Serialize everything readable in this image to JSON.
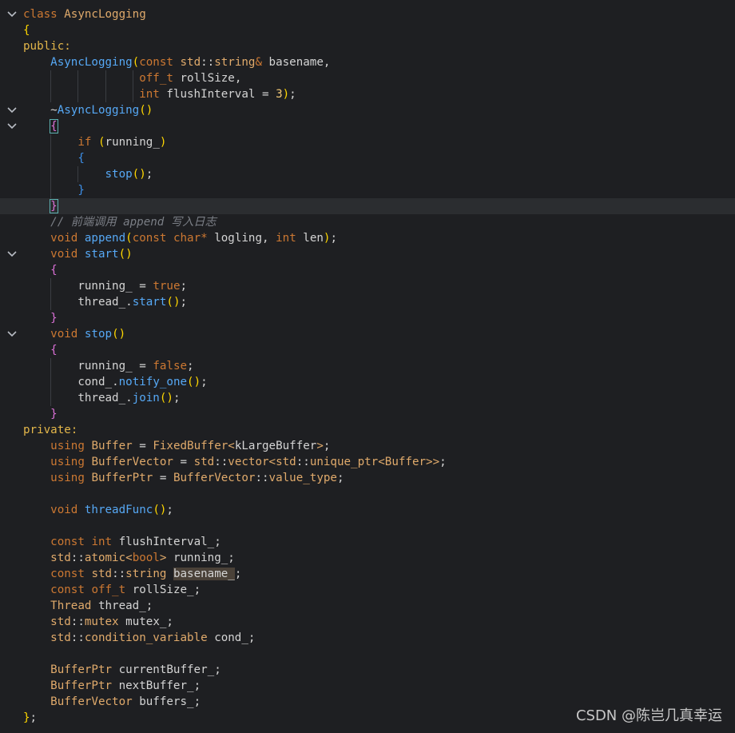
{
  "code_lines": [
    "class AsyncLogging",
    "{",
    "public:",
    "    AsyncLogging(const std::string& basename,",
    "                 off_t rollSize,",
    "                 int flushInterval = 3);",
    "    ~AsyncLogging()",
    "    {",
    "        if (running_)",
    "        {",
    "            stop();",
    "        }",
    "    }",
    "    // 前端调用 append 写入日志",
    "    void append(const char* logling, int len);",
    "    void start()",
    "    {",
    "        running_ = true;",
    "        thread_.start();",
    "    }",
    "    void stop()",
    "    {",
    "        running_ = false;",
    "        cond_.notify_one();",
    "        thread_.join();",
    "    }",
    "private:",
    "    using Buffer = FixedBuffer<kLargeBuffer>;",
    "    using BufferVector = std::vector<std::unique_ptr<Buffer>>;",
    "    using BufferPtr = BufferVector::value_type;",
    "",
    "    void threadFunc();",
    "",
    "    const int flushInterval_;",
    "    std::atomic<bool> running_;",
    "    const std::string basename_;",
    "    const off_t rollSize_;",
    "    Thread thread_;",
    "    std::mutex mutex_;",
    "    std::condition_variable cond_;",
    "",
    "    BufferPtr currentBuffer_;",
    "    BufferPtr nextBuffer_;",
    "    BufferVector buffers_;",
    "};"
  ],
  "fold_icon": "chevron-down-icon",
  "watermark": "CSDN @陈岂几真幸运"
}
